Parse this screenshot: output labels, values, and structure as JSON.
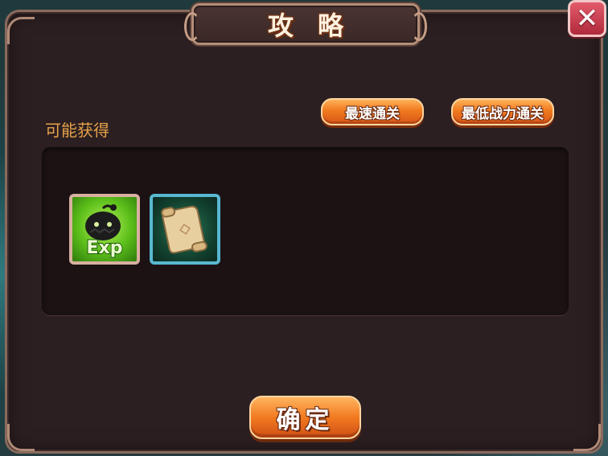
{
  "dialog": {
    "title": "攻略",
    "close_label": "✕"
  },
  "section": {
    "possible_drops_label": "可能获得"
  },
  "buttons": {
    "fastest_clear": "最速通关",
    "lowest_power_clear": "最低战力通关",
    "confirm": "确定"
  },
  "rewards": [
    {
      "icon": "exp-potion-icon",
      "text": "Exp",
      "frame_color": "#d8b0a0"
    },
    {
      "icon": "scroll-icon",
      "frame_color": "#58b8d0"
    }
  ],
  "colors": {
    "accent_orange": "#f07a1e",
    "label_gold": "#e6a24a",
    "close_red": "#c8394a"
  }
}
